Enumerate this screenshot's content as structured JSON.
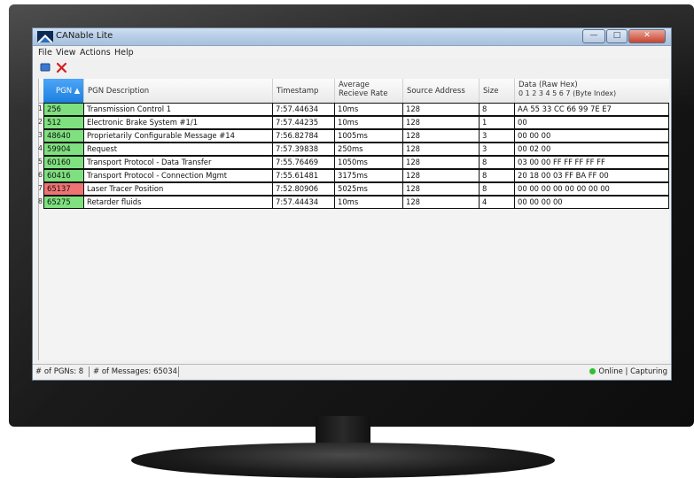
{
  "window": {
    "title": "CANable Lite"
  },
  "menu": [
    "File",
    "View",
    "Actions",
    "Help"
  ],
  "table": {
    "headers": {
      "pgn": "PGN ▲",
      "description": "PGN Description",
      "timestamp": "Timestamp",
      "rate_line1": "Average",
      "rate_line2": "Recieve Rate",
      "source": "Source Address",
      "size": "Size",
      "data_line1": "Data (Raw Hex)",
      "data_line2": "0  1  2  3  4  5  6  7 (Byte Index)"
    },
    "rows": [
      {
        "num": "1",
        "pgn": "256",
        "desc": "Transmission Control 1",
        "time": "7:57.44634",
        "rate": "10ms",
        "src": "128",
        "size": "8",
        "data": "AA 55 33 CC 66 99 7E E7",
        "color": "green"
      },
      {
        "num": "2",
        "pgn": "512",
        "desc": "Electronic Brake System #1/1",
        "time": "7:57.44235",
        "rate": "10ms",
        "src": "128",
        "size": "1",
        "data": "00",
        "color": "green"
      },
      {
        "num": "3",
        "pgn": "48640",
        "desc": "Proprietarily Configurable Message #14",
        "time": "7:56.82784",
        "rate": "1005ms",
        "src": "128",
        "size": "3",
        "data": "00 00 00",
        "color": "green"
      },
      {
        "num": "4",
        "pgn": "59904",
        "desc": "Request",
        "time": "7:57.39838",
        "rate": "250ms",
        "src": "128",
        "size": "3",
        "data": "00 02 00",
        "color": "green"
      },
      {
        "num": "5",
        "pgn": "60160",
        "desc": "Transport Protocol - Data Transfer",
        "time": "7:55.76469",
        "rate": "1050ms",
        "src": "128",
        "size": "8",
        "data": "03 00 00 FF FF FF FF FF",
        "color": "green"
      },
      {
        "num": "6",
        "pgn": "60416",
        "desc": "Transport Protocol - Connection Mgmt",
        "time": "7:55.61481",
        "rate": "3175ms",
        "src": "128",
        "size": "8",
        "data": "20 18 00 03 FF BA FF 00",
        "color": "green"
      },
      {
        "num": "7",
        "pgn": "65137",
        "desc": "Laser Tracer Position",
        "time": "7:52.80906",
        "rate": "5025ms",
        "src": "128",
        "size": "8",
        "data": "00 00 00 00 00 00 00 00",
        "color": "red"
      },
      {
        "num": "8",
        "pgn": "65275",
        "desc": "Retarder fluids",
        "time": "7:57.44434",
        "rate": "10ms",
        "src": "128",
        "size": "4",
        "data": "00 00 00 00",
        "color": "green"
      }
    ]
  },
  "status": {
    "pgn_count": "# of PGNs: 8",
    "msg_count": "# of Messages: 65034",
    "state": "Online | Capturing"
  },
  "colors": {
    "green": "#7ee07e",
    "red": "#ef7373",
    "online": "#2fbf2f"
  },
  "icons": [
    "app-icon",
    "minimize-icon",
    "maximize-icon",
    "close-icon",
    "connect-icon",
    "clear-icon"
  ]
}
